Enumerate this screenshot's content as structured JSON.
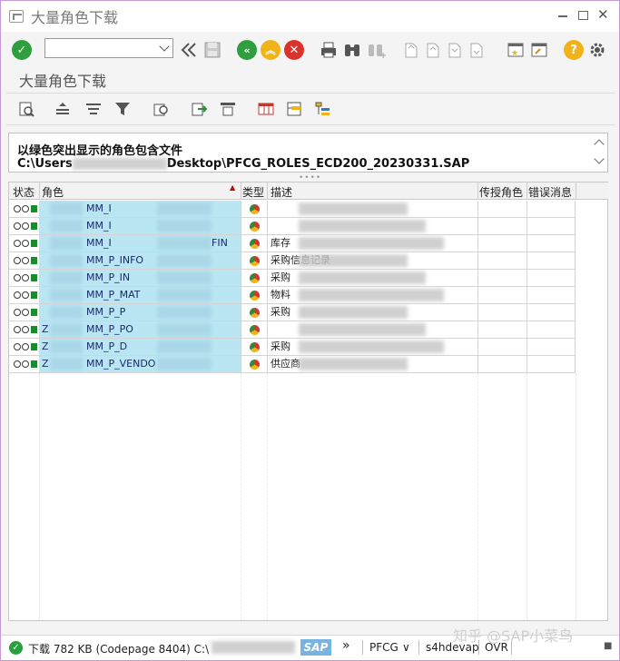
{
  "window": {
    "title": "大量角色下载"
  },
  "toolbar": {
    "command_value": "",
    "command_placeholder": ""
  },
  "page": {
    "heading": "大量角色下载"
  },
  "info": {
    "line1": "以绿色突出显示的角色包含文件",
    "line2_prefix": "C:\\Users",
    "line2_suffix": "Desktop\\PFCG_ROLES_ECD200_20230331.SAP"
  },
  "grid": {
    "columns": [
      "状态",
      "角色",
      "类型",
      "描述",
      "传授角色",
      "错误消息"
    ],
    "rows": [
      {
        "role_start": "",
        "role_mid": "MM_I",
        "role_end": "",
        "desc": ""
      },
      {
        "role_start": "",
        "role_mid": "MM_I",
        "role_end": "",
        "desc": ""
      },
      {
        "role_start": "",
        "role_mid": "MM_I",
        "role_end": "FIN",
        "desc": "库存"
      },
      {
        "role_start": "",
        "role_mid": "MM_P_INFO",
        "role_end": "",
        "desc": "采购信息记录"
      },
      {
        "role_start": "",
        "role_mid": "MM_P_IN",
        "role_end": "",
        "desc": "采购"
      },
      {
        "role_start": "",
        "role_mid": "MM_P_MAT",
        "role_end": "",
        "desc": "物料"
      },
      {
        "role_start": "",
        "role_mid": "MM_P_P",
        "role_end": "",
        "desc": "采购"
      },
      {
        "role_start": "Z",
        "role_mid": "MM_P_PO",
        "role_end": "",
        "desc": ""
      },
      {
        "role_start": "Z",
        "role_mid": "MM_P_D",
        "role_end": "",
        "desc": "采购"
      },
      {
        "role_start": "Z",
        "role_mid": "MM_P_VENDO",
        "role_end": "",
        "desc": "供应商"
      }
    ]
  },
  "statusbar": {
    "message_prefix": "下载 782 KB (Codepage 8404) C:\\Us",
    "sap_logo": "SAP",
    "transaction": "PFCG",
    "server": "s4hdevap",
    "mode": "OVR"
  },
  "watermark": {
    "text": "知乎 @SAP小菜鸟"
  },
  "colors": {
    "role_highlight": "#b9e6f2",
    "status_green": "#1c8a2e",
    "window_border": "#c49bd8"
  }
}
